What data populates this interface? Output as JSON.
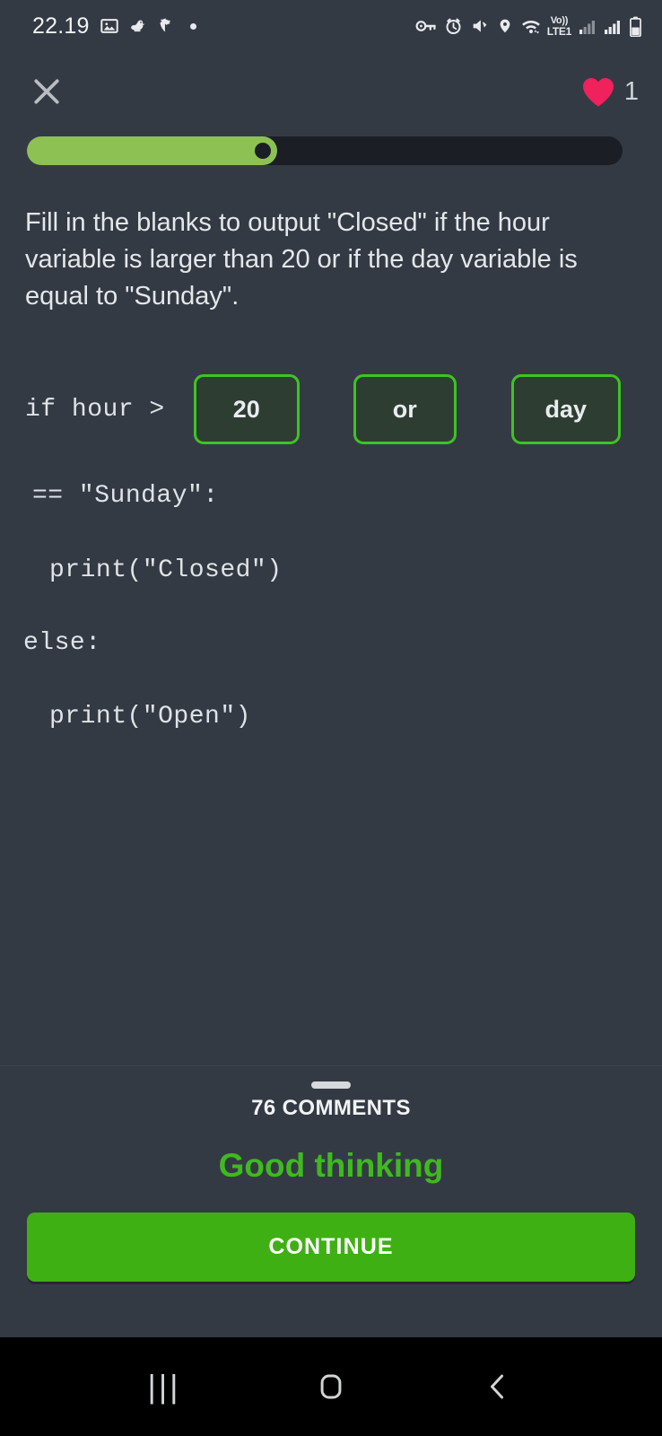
{
  "status_bar": {
    "clock": "22.19",
    "left_icons": [
      "image-icon",
      "duck-icon",
      "shield-icon",
      "dot-icon"
    ],
    "right_icons": [
      "key-icon",
      "alarm-icon",
      "mute-icon",
      "location-icon",
      "wifi-icon"
    ],
    "volte_top": "Vo))",
    "volte_bottom": "LTE1",
    "signal_icons": [
      "signal-bars-1-icon",
      "signal-bars-2-icon"
    ],
    "battery_icon": "battery-icon"
  },
  "header": {
    "close_icon": "close-icon",
    "hearts_icon": "heart-icon",
    "hearts_count": "1"
  },
  "progress": {
    "percent": 42,
    "fill_color": "#8dc153",
    "track_color": "#1b1f25"
  },
  "question": {
    "prompt": "Fill in the blanks to output \"Closed\" if the hour variable is larger than 20 or if the day variable is equal to \"Sunday\"."
  },
  "code": {
    "line_if_prefix": "if hour >",
    "blanks": [
      {
        "value": "20"
      },
      {
        "value": "or"
      },
      {
        "value": "day"
      }
    ],
    "line_sunday": "== \"Sunday\":",
    "line_print_closed": "print(\"Closed\")",
    "line_else": "else:",
    "line_print_open": "print(\"Open\")"
  },
  "feedback": {
    "comments_label": "76 COMMENTS",
    "result_message": "Good thinking",
    "result_color": "#3fb91f",
    "continue_label": "CONTINUE",
    "continue_color": "#3fb014"
  },
  "nav_bar": {
    "recents_label": "|||",
    "home_icon": "home-icon",
    "back_icon": "back-icon"
  }
}
